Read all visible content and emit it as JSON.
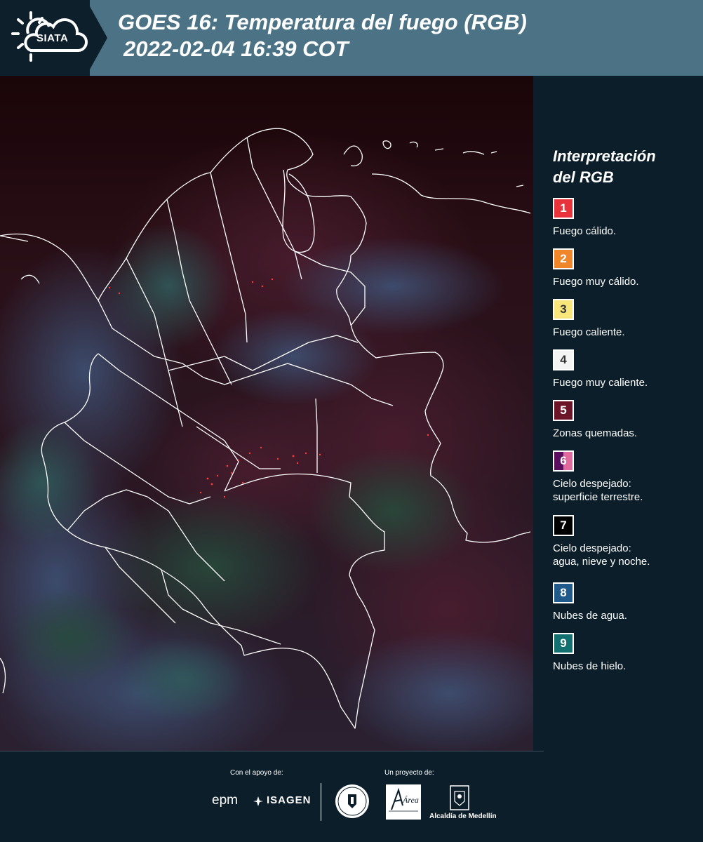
{
  "header": {
    "logo_text": "SIATA",
    "title_line1": "GOES 16: Temperatura del fuego (RGB)",
    "title_line2": "2022-02-04 16:39 COT"
  },
  "legend": {
    "title_line1": "Interpretación",
    "title_line2": "del RGB",
    "items": [
      {
        "number": "1",
        "label": "Fuego cálido.",
        "color": "#e8323c"
      },
      {
        "number": "2",
        "label": "Fuego muy cálido.",
        "color": "#f0862a"
      },
      {
        "number": "3",
        "label": "Fuego caliente.",
        "color": "#f8e67a"
      },
      {
        "number": "4",
        "label": "Fuego muy caliente.",
        "color": "#f4f4f4"
      },
      {
        "number": "5",
        "label": "Zonas quemadas.",
        "color": "#6e1428"
      },
      {
        "number": "6",
        "label_line1": "Cielo despejado:",
        "label_line2": "superficie terrestre.",
        "color": "#5a0f5e",
        "color2": "#e06a9e"
      },
      {
        "number": "7",
        "label_line1": "Cielo despejado:",
        "label_line2": "agua, nieve y noche.",
        "color": "#000000"
      },
      {
        "number": "8",
        "label": "Nubes de agua.",
        "color": "#1f5a8a"
      },
      {
        "number": "9",
        "label": "Nubes de hielo.",
        "color": "#127070"
      }
    ]
  },
  "footer": {
    "support_caption": "Con el apoyo de:",
    "project_caption": "Un proyecto de:",
    "sponsor_1": "epm",
    "sponsor_2": "ISAGEN",
    "partner_1_text": "METROPOLITANA Valle de Aburrá",
    "partner_1_script": "Área",
    "partner_2": "Alcaldía de Medellín"
  }
}
